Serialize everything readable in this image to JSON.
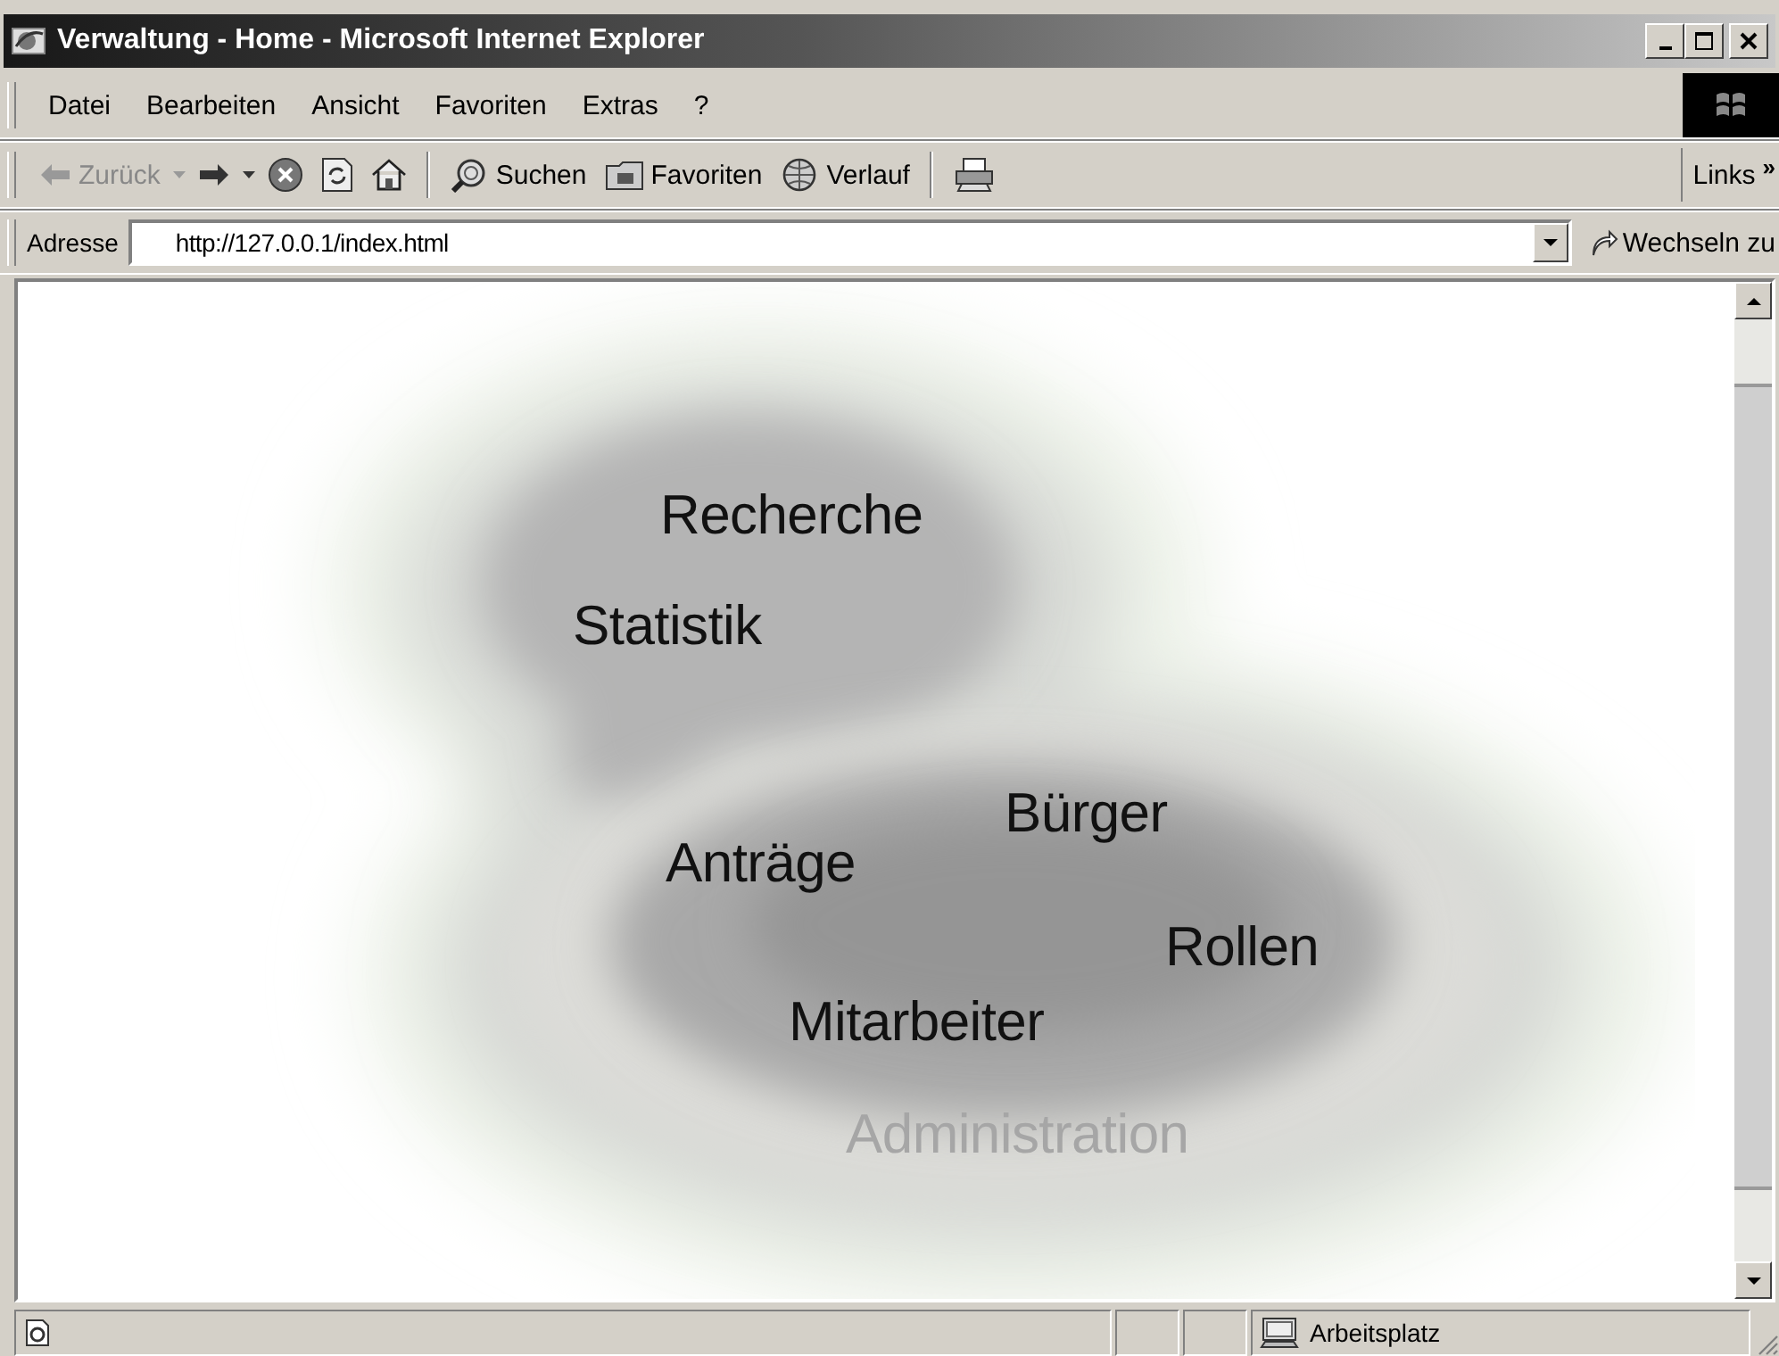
{
  "window": {
    "title": "Verwaltung - Home - Microsoft Internet Explorer"
  },
  "menu": [
    "Datei",
    "Bearbeiten",
    "Ansicht",
    "Favoriten",
    "Extras",
    "?"
  ],
  "toolbar": {
    "buttons": [
      {
        "kind": "back",
        "label": "Zurück",
        "disabled": true
      },
      {
        "kind": "forward",
        "disabled": false
      },
      {
        "kind": "stop"
      },
      {
        "kind": "refresh"
      },
      {
        "kind": "home"
      },
      {
        "kind": "separator"
      },
      {
        "kind": "search",
        "label": "Suchen"
      },
      {
        "kind": "favorites",
        "label": "Favoriten"
      },
      {
        "kind": "history",
        "label": "Verlauf"
      },
      {
        "kind": "separator"
      },
      {
        "kind": "print"
      }
    ],
    "links": "Links",
    "chevron": "»"
  },
  "address_bar": {
    "label": "Adresse",
    "value": "http://127.0.0.1/index.html",
    "go": "Wechseln zu"
  },
  "page": {
    "items": [
      {
        "label": "Recherche",
        "disabled": false
      },
      {
        "label": "Statistik",
        "disabled": false
      },
      {
        "label": "Bürger",
        "disabled": false
      },
      {
        "label": "Anträge",
        "disabled": false
      },
      {
        "label": "Rollen",
        "disabled": false
      },
      {
        "label": "Mitarbeiter",
        "disabled": false
      },
      {
        "label": "Administration",
        "disabled": true
      }
    ]
  },
  "status_bar": {
    "zone": "Arbeitsplatz"
  }
}
